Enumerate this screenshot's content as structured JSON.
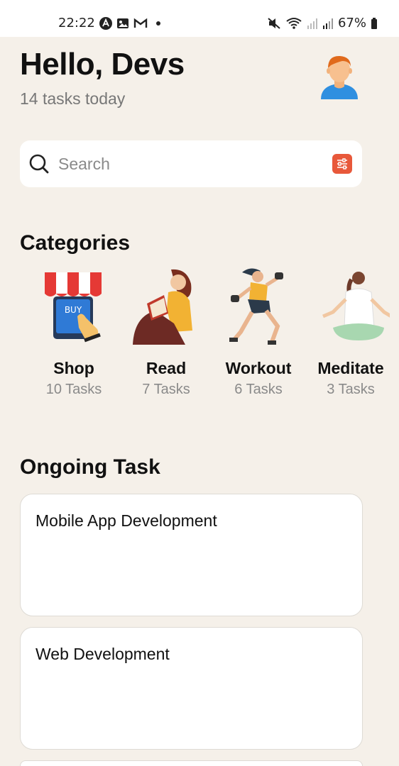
{
  "status_bar": {
    "time": "22:22",
    "battery": "67%",
    "left_icons": [
      "app-a-icon",
      "gallery-icon",
      "gmail-icon",
      "notification-dot-icon"
    ],
    "right_icons": [
      "mute-icon",
      "wifi-icon",
      "signal-icon",
      "signal-icon-2",
      "battery-icon"
    ]
  },
  "header": {
    "greeting": "Hello, Devs",
    "subtitle": "14 tasks today",
    "avatar_icon": "user-avatar-icon"
  },
  "search": {
    "placeholder": "Search",
    "value": "",
    "filter_icon": "filter-sliders-icon",
    "accent_color": "#e8583a"
  },
  "categories": {
    "title": "Categories",
    "items": [
      {
        "name": "Shop",
        "count": "10 Tasks",
        "icon": "shop-illustration"
      },
      {
        "name": "Read",
        "count": "7 Tasks",
        "icon": "read-illustration"
      },
      {
        "name": "Workout",
        "count": "6 Tasks",
        "icon": "workout-illustration"
      },
      {
        "name": "Meditate",
        "count": "3 Tasks",
        "icon": "meditate-illustration"
      }
    ]
  },
  "ongoing": {
    "title": "Ongoing Task",
    "tasks": [
      {
        "title": "Mobile App Development"
      },
      {
        "title": "Web Development"
      },
      {
        "title": ""
      }
    ]
  },
  "colors": {
    "background": "#f5f0e9",
    "card": "#ffffff",
    "muted_text": "#8a8a8a"
  }
}
